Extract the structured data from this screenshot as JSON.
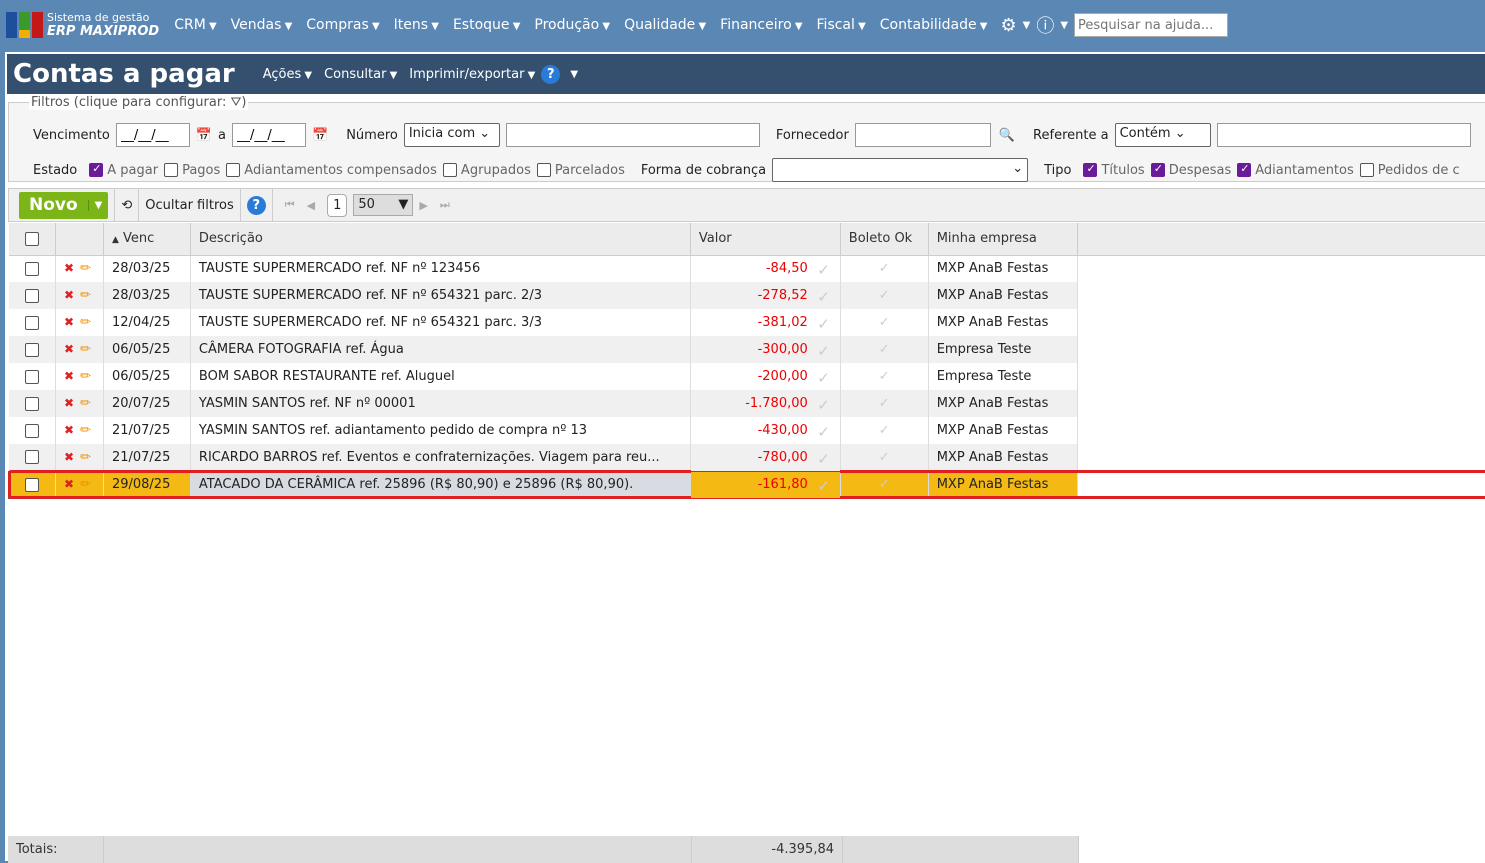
{
  "app": {
    "logo_line1": "Sistema de gestão",
    "logo_line2": "ERP MAXIPROD",
    "menu": [
      "CRM",
      "Vendas",
      "Compras",
      "Itens",
      "Estoque",
      "Produção",
      "Qualidade",
      "Financeiro",
      "Fiscal",
      "Contabilidade"
    ],
    "search_placeholder": "Pesquisar na ajuda..."
  },
  "page": {
    "title": "Contas a pagar",
    "menu": [
      "Ações",
      "Consultar",
      "Imprimir/exportar"
    ],
    "help": "?"
  },
  "filters": {
    "legend": "Filtros (clique para configurar:",
    "legend_end": ")",
    "vencimento": "Vencimento",
    "date_placeholder": "__/__/__",
    "a": "a",
    "numero": "Número",
    "numero_op": "Inicia com",
    "fornecedor": "Fornecedor",
    "referente": "Referente a",
    "referente_op": "Contém",
    "estado": "Estado",
    "estado_opts": [
      {
        "label": "A pagar",
        "on": true
      },
      {
        "label": "Pagos",
        "on": false
      },
      {
        "label": "Adiantamentos compensados",
        "on": false
      },
      {
        "label": "Agrupados",
        "on": false
      },
      {
        "label": "Parcelados",
        "on": false
      }
    ],
    "forma": "Forma de cobrança",
    "tipo": "Tipo",
    "tipo_opts": [
      {
        "label": "Títulos",
        "on": true
      },
      {
        "label": "Despesas",
        "on": true
      },
      {
        "label": "Adiantamentos",
        "on": true
      },
      {
        "label": "Pedidos de c",
        "on": false
      }
    ]
  },
  "toolbar": {
    "novo": "Novo",
    "ocultar": "Ocultar filtros",
    "page": "1",
    "per_page": "50"
  },
  "columns": [
    "Venc",
    "Descrição",
    "Valor",
    "Boleto Ok",
    "Minha empresa"
  ],
  "rows": [
    {
      "venc": "28/03/25",
      "desc": "TAUSTE SUPERMERCADO ref. NF nº 123456",
      "valor": "-84,50",
      "empresa": "MXP AnaB Festas"
    },
    {
      "venc": "28/03/25",
      "desc": "TAUSTE SUPERMERCADO ref. NF nº 654321 parc. 2/3",
      "valor": "-278,52",
      "empresa": "MXP AnaB Festas"
    },
    {
      "venc": "12/04/25",
      "desc": "TAUSTE SUPERMERCADO ref. NF nº 654321 parc. 3/3",
      "valor": "-381,02",
      "empresa": "MXP AnaB Festas"
    },
    {
      "venc": "06/05/25",
      "desc": "CÂMERA FOTOGRAFIA ref. Água",
      "valor": "-300,00",
      "empresa": "Empresa Teste"
    },
    {
      "venc": "06/05/25",
      "desc": "BOM SABOR RESTAURANTE ref. Aluguel",
      "valor": "-200,00",
      "empresa": "Empresa Teste"
    },
    {
      "venc": "20/07/25",
      "desc": "YASMIN SANTOS ref. NF nº 00001",
      "valor": "-1.780,00",
      "empresa": "MXP AnaB Festas"
    },
    {
      "venc": "21/07/25",
      "desc": "YASMIN SANTOS ref. adiantamento pedido de compra nº 13",
      "valor": "-430,00",
      "empresa": "MXP AnaB Festas"
    },
    {
      "venc": "21/07/25",
      "desc": "RICARDO BARROS ref. Eventos e confraternizações. Viagem para reu...",
      "valor": "-780,00",
      "empresa": "MXP AnaB Festas"
    },
    {
      "venc": "29/08/25",
      "desc": "ATACADO DA CERÂMICA ref. 25896 (R$ 80,90) e 25896 (R$ 80,90).",
      "valor": "-161,80",
      "empresa": "MXP AnaB Festas",
      "selected": true
    }
  ],
  "totals": {
    "label": "Totais:",
    "valor": "-4.395,84"
  }
}
